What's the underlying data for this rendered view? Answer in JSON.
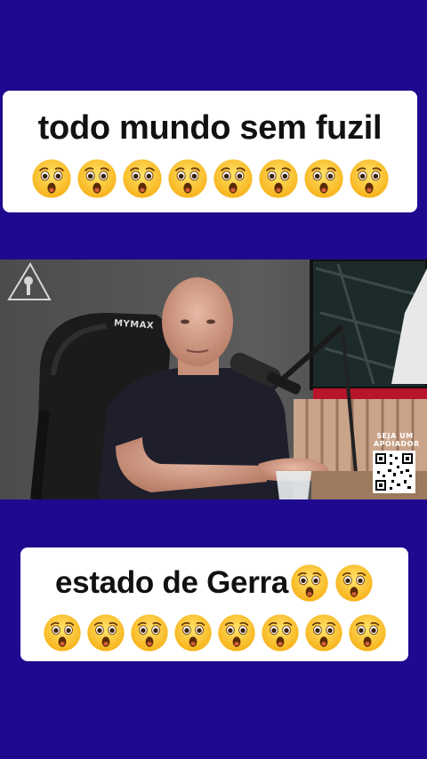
{
  "top_caption": {
    "text": "todo mundo sem fuzil",
    "emoji": "astonished-face",
    "emoji_count": 8
  },
  "bottom_caption": {
    "text": "estado de Gerra",
    "emoji": "astonished-face",
    "inline_emoji_count": 2,
    "row_emoji_count": 8
  },
  "video": {
    "chair_brand": "MYMAX",
    "qr_label_line1": "SEJA UM",
    "qr_label_line2": "APOIADOR"
  },
  "colors": {
    "background": "#1f0a8f",
    "caption_bg": "#ffffff",
    "caption_text": "#111111"
  }
}
